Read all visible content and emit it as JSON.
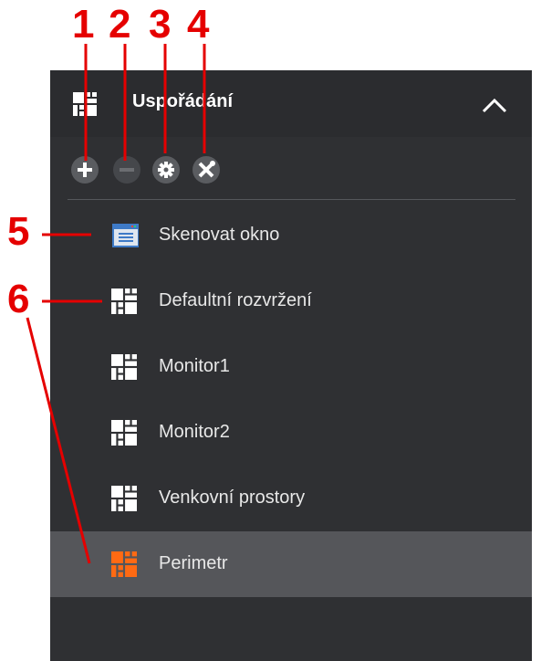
{
  "panel": {
    "title": "Uspořádání",
    "title_icon": "layout-grid-icon",
    "collapse_icon": "chevron-up-icon"
  },
  "toolbar": [
    {
      "name": "add",
      "icon": "plus-icon"
    },
    {
      "name": "remove",
      "icon": "minus-icon"
    },
    {
      "name": "settings",
      "icon": "gear-icon"
    },
    {
      "name": "tools",
      "icon": "wrench-screwdriver-icon"
    }
  ],
  "items": [
    {
      "label": "Skenovat okno",
      "icon": "window-icon",
      "selected": false
    },
    {
      "label": "Defaultní rozvržení",
      "icon": "layout-grid-icon",
      "selected": false
    },
    {
      "label": "Monitor1",
      "icon": "layout-grid-icon",
      "selected": false
    },
    {
      "label": "Monitor2",
      "icon": "layout-grid-icon",
      "selected": false
    },
    {
      "label": "Venkovní prostory",
      "icon": "layout-grid-icon",
      "selected": false
    },
    {
      "label": "Perimetr",
      "icon": "layout-grid-icon",
      "selected": true
    }
  ],
  "callouts": [
    "1",
    "2",
    "3",
    "4",
    "5",
    "6"
  ],
  "colors": {
    "panel": "#2f3033",
    "selected": "#55565a",
    "accent": "#ff6a13",
    "callout": "#e50000"
  }
}
